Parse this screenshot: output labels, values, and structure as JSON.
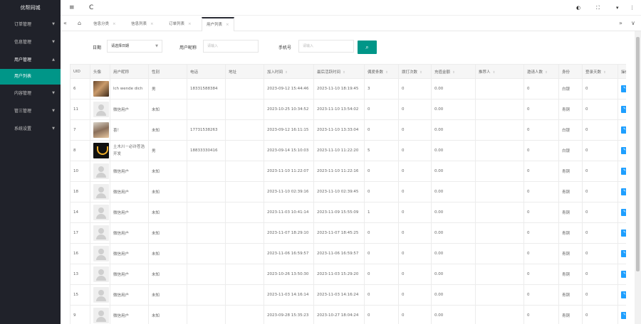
{
  "app": {
    "title": "优帮同城"
  },
  "sidebar": {
    "items": [
      {
        "label": "订单管理",
        "open": false
      },
      {
        "label": "信息管理",
        "open": false
      },
      {
        "label": "用户管理",
        "open": true,
        "sub": [
          {
            "label": "用户列表",
            "active": true
          }
        ]
      },
      {
        "label": "内容管理",
        "open": false
      },
      {
        "label": "管三管理",
        "open": false
      },
      {
        "label": "系统设置",
        "open": false
      }
    ]
  },
  "header": {
    "menu_icon": "≡",
    "refresh_icon": "C",
    "right_icons": [
      "◐",
      "⛶",
      "▾",
      "⋮"
    ]
  },
  "tabs": {
    "items": [
      {
        "label": "信息分类"
      },
      {
        "label": "信息列表"
      },
      {
        "label": "订单列表"
      },
      {
        "label": "用户列表",
        "active": true
      }
    ],
    "close": "×",
    "left_icon": "«",
    "home_icon": "⌂",
    "right_icon": "»",
    "down_icon": "∨"
  },
  "filters": {
    "date_label": "日期",
    "date_select": "请选择日期",
    "nickname_label": "用户昵称",
    "nickname_placeholder": "请输入",
    "phone_label": "手机号",
    "phone_placeholder": "请输入",
    "search_icon": "⌕"
  },
  "table": {
    "columns": [
      "UID",
      "头像",
      "用户昵称",
      "性别",
      "电话",
      "地址",
      "加入时间",
      "最后活跃时间",
      "偶爱条数",
      "拨打次数",
      "充值金额",
      "推荐人",
      "邀请人数",
      "身份",
      "登录天数",
      "操作"
    ],
    "sortable": [
      false,
      false,
      false,
      false,
      false,
      false,
      true,
      true,
      true,
      true,
      true,
      true,
      true,
      false,
      true,
      false
    ],
    "sort_icon": "⇕",
    "edit_label": "✎ 详情",
    "rows": [
      {
        "uid": "6",
        "avatar": "av-photo1",
        "nickname": "lch wende dich",
        "gender": "男",
        "phone": "18331588384",
        "address": "",
        "join": "2023-09-12 15:44:46",
        "last": "2023-11-10 18:19:45",
        "a": "3",
        "b": "0",
        "c": "0.00",
        "ref": "",
        "inv": "0",
        "role": "白银",
        "days": "0"
      },
      {
        "uid": "11",
        "avatar": "av-placeholder",
        "nickname": "微信用户",
        "gender": "未知",
        "phone": "",
        "address": "",
        "join": "2023-10-25 10:34:52",
        "last": "2023-11-10 13:54:02",
        "a": "0",
        "b": "0",
        "c": "0.00",
        "ref": "",
        "inv": "0",
        "role": "青铜",
        "days": "0"
      },
      {
        "uid": "7",
        "avatar": "av-photo2",
        "nickname": "喜！",
        "gender": "未知",
        "phone": "17731538263",
        "address": "",
        "join": "2023-09-12 16:11:15",
        "last": "2023-11-10 13:33:04",
        "a": "0",
        "b": "0",
        "c": "0.00",
        "ref": "",
        "inv": "0",
        "role": "白银",
        "days": "0"
      },
      {
        "uid": "8",
        "avatar": "av-logo",
        "nickname": "土木川－必许苍浩开发",
        "gender": "男",
        "phone": "18833330416",
        "address": "",
        "join": "2023-09-14 15:10:03",
        "last": "2023-11-10 11:22:20",
        "a": "5",
        "b": "0",
        "c": "0.00",
        "ref": "",
        "inv": "0",
        "role": "白银",
        "days": "0"
      },
      {
        "uid": "10",
        "avatar": "av-placeholder",
        "nickname": "微信用户",
        "gender": "未知",
        "phone": "",
        "address": "",
        "join": "2023-11-10 11:22:07",
        "last": "2023-11-10 11:22:16",
        "a": "0",
        "b": "0",
        "c": "0.00",
        "ref": "",
        "inv": "0",
        "role": "青铜",
        "days": "0"
      },
      {
        "uid": "18",
        "avatar": "av-placeholder",
        "nickname": "微信用户",
        "gender": "未知",
        "phone": "",
        "address": "",
        "join": "2023-11-10 02:39:16",
        "last": "2023-11-10 02:39:45",
        "a": "0",
        "b": "0",
        "c": "0.00",
        "ref": "",
        "inv": "0",
        "role": "青铜",
        "days": "0"
      },
      {
        "uid": "14",
        "avatar": "av-placeholder",
        "nickname": "微信用户",
        "gender": "未知",
        "phone": "",
        "address": "",
        "join": "2023-11-03 10:41:14",
        "last": "2023-11-09 15:55:09",
        "a": "1",
        "b": "0",
        "c": "0.00",
        "ref": "",
        "inv": "0",
        "role": "青铜",
        "days": "0"
      },
      {
        "uid": "17",
        "avatar": "av-placeholder",
        "nickname": "微信用户",
        "gender": "未知",
        "phone": "",
        "address": "",
        "join": "2023-11-07 18:29:10",
        "last": "2023-11-07 18:45:25",
        "a": "0",
        "b": "0",
        "c": "0.00",
        "ref": "",
        "inv": "0",
        "role": "青铜",
        "days": "0"
      },
      {
        "uid": "16",
        "avatar": "av-placeholder",
        "nickname": "微信用户",
        "gender": "未知",
        "phone": "",
        "address": "",
        "join": "2023-11-06 16:59:57",
        "last": "2023-11-06 16:59:57",
        "a": "0",
        "b": "0",
        "c": "0.00",
        "ref": "",
        "inv": "0",
        "role": "青铜",
        "days": "0"
      },
      {
        "uid": "13",
        "avatar": "av-placeholder",
        "nickname": "微信用户",
        "gender": "未知",
        "phone": "",
        "address": "",
        "join": "2023-10-26 13:50:30",
        "last": "2023-11-03 15:29:20",
        "a": "0",
        "b": "0",
        "c": "0.00",
        "ref": "",
        "inv": "0",
        "role": "青铜",
        "days": "0"
      },
      {
        "uid": "15",
        "avatar": "av-placeholder",
        "nickname": "微信用户",
        "gender": "未知",
        "phone": "",
        "address": "",
        "join": "2023-11-03 14:16:14",
        "last": "2023-11-03 14:16:24",
        "a": "0",
        "b": "0",
        "c": "0.00",
        "ref": "",
        "inv": "0",
        "role": "青铜",
        "days": "0"
      },
      {
        "uid": "9",
        "avatar": "av-placeholder",
        "nickname": "微信用户",
        "gender": "未知",
        "phone": "",
        "address": "",
        "join": "2023-09-28 15:35:23",
        "last": "2023-10-27 18:04:24",
        "a": "0",
        "b": "0",
        "c": "0.00",
        "ref": "",
        "inv": "0",
        "role": "青铜",
        "days": "0"
      }
    ]
  }
}
